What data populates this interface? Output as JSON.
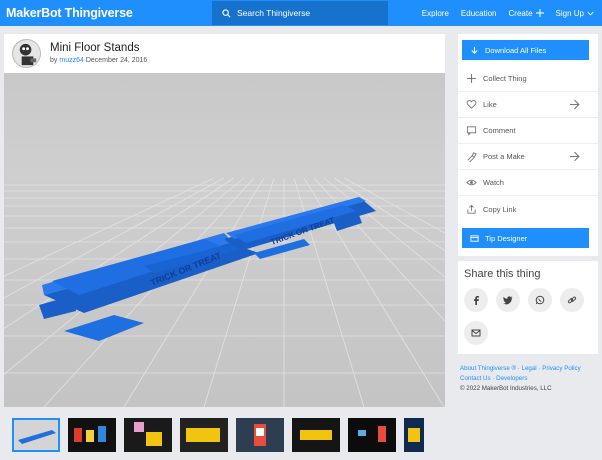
{
  "nav": {
    "logo_a": "MakerBot",
    "logo_b": "Thingiverse",
    "search_placeholder": "Search Thingiverse",
    "explore": "Explore",
    "education": "Education",
    "create": "Create",
    "signup": "Sign Up"
  },
  "thing": {
    "title": "Mini Floor Stands",
    "by": "by",
    "author": "muzz64",
    "date": "December 24, 2016"
  },
  "model_text": [
    "TRICK OR TREAT",
    "TRICK OR TREAT"
  ],
  "actions": {
    "download": "Download All Files",
    "collect": "Collect Thing",
    "like": "Like",
    "comment": "Comment",
    "post_make": "Post a Make",
    "watch": "Watch",
    "copy_link": "Copy Link",
    "tip": "Tip Designer"
  },
  "share": {
    "title": "Share this thing",
    "buttons": [
      "facebook-icon",
      "twitter-icon",
      "whatsapp-icon",
      "link-icon",
      "email-icon"
    ]
  },
  "footer": {
    "about": "About Thingiverse ®",
    "legal": "Legal",
    "privacy": "Privacy Policy",
    "contact": "Contact Us",
    "developers": "Developers",
    "copyright": "© 2022 MakerBot Industries, LLC"
  },
  "colors": {
    "brand_blue": "#1f8ffd",
    "search_bg": "#1672cc",
    "model_blue": "#1e6fe0",
    "page_bg": "#e8eaed"
  },
  "thumbnail_count": 8
}
